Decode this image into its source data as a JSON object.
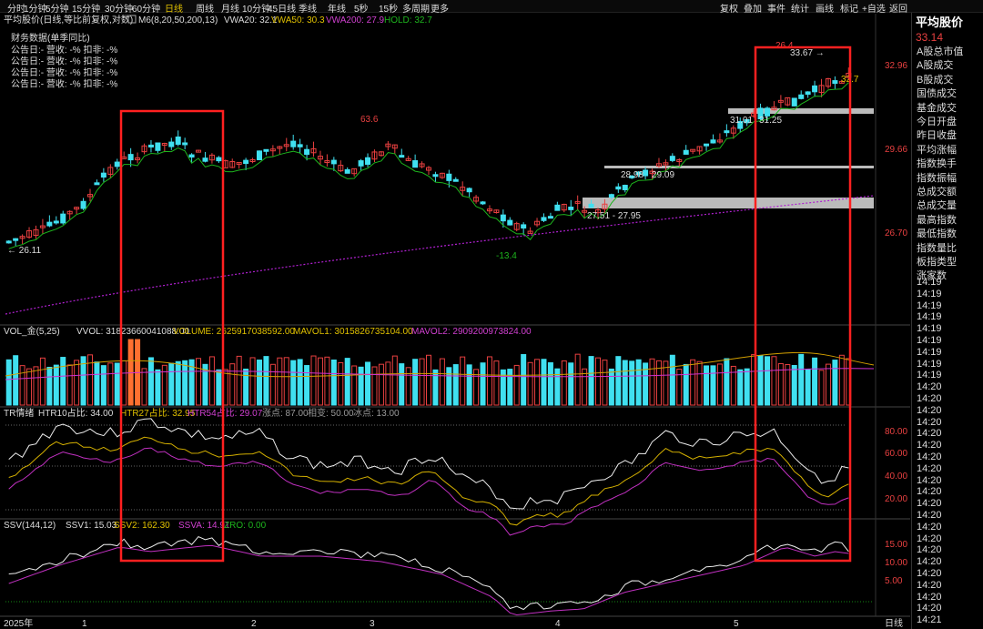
{
  "topbar": {
    "periods": [
      "分时",
      "1分钟",
      "5分钟",
      "15分钟",
      "30分钟",
      "60分钟",
      "日线",
      "周线",
      "月线",
      "10分钟",
      "45日线",
      "季线",
      "年线",
      "5秒",
      "15秒",
      "多周期",
      "更多"
    ],
    "active_period": "日线",
    "actions": [
      "复权",
      "叠加",
      "事件",
      "统计",
      "画线",
      "标记",
      "+自选",
      "返回"
    ]
  },
  "main_header": {
    "title": "平均股价(日线,等比前复权,对数)",
    "indicator": "M6(8,20,50,200,13)",
    "vwa20": "VWA20: 32.1",
    "vwa50": "VWA50: 30.3",
    "vwa200": "VWA200: 27.9",
    "hold": "HOLD: 32.7"
  },
  "finance": {
    "title": "财务数据(单季同比)",
    "rows": [
      "公告日:-  营收: -%  扣非: -%",
      "公告日:-  营收: -%  扣非: -%",
      "公告日:-  营收: -%  扣非: -%",
      "公告日:-  营收: -%  扣非: -%"
    ]
  },
  "price_axis": [
    "32.96",
    "29.66",
    "26.70"
  ],
  "annotations": {
    "low_left": "26.11",
    "peak_mid": "63.6",
    "trough": "-13.4",
    "peak_right": "26.4",
    "hi": "33.67",
    "last": "32.7",
    "s1": "31.01",
    "s2": "31.25",
    "s3": "28.98",
    "s4": "29.09",
    "s5": "27.51 - 27.95"
  },
  "vol_header": {
    "name": "VOL_金(5,25)",
    "vvol": "VVOL: 31823660041088.00",
    "volume": "VOLUME: 2625917038592.00",
    "mavol1": "MAVOL1: 3015826735104.00",
    "mavol2": "MAVOL2: 2909200973824.00"
  },
  "tr_header": {
    "name": "TR情绪",
    "htr10": "HTR10占比: 34.00",
    "htr27": "HTR27占比: 32.95",
    "htr54": "HTR54占比: 29.07",
    "hot": "涨点: 87.00",
    "neutral": "相变: 50.00",
    "cold": "冰点: 13.00"
  },
  "tr_axis": [
    "80.00",
    "60.00",
    "40.00",
    "20.00"
  ],
  "ssv_header": {
    "name": "SSV(144,12)",
    "ssv1": "SSV1: 15.03",
    "ssv2": "SSV2: 162.30",
    "ssva": "SSVA: 14.91",
    "zro": "ZRO: 0.00"
  },
  "ssv_axis": [
    "15.00",
    "10.00",
    "5.00"
  ],
  "x_axis": [
    "2025年",
    "1",
    "2",
    "3",
    "4",
    "5"
  ],
  "x_axis_right": "日线",
  "sidebar": {
    "title": "平均股价",
    "price": "33.14",
    "items": [
      "A股总市值",
      "A股成交",
      "B股成交",
      "国债成交",
      "基金成交",
      "今日开盘",
      "昨日收盘",
      "平均涨幅",
      "指数换手",
      "指数振幅",
      "总成交额",
      "总成交量",
      "最高指数",
      "最低指数",
      "指数量比",
      "板指类型",
      "涨家数"
    ],
    "times": [
      "14:19",
      "14:19",
      "14:19",
      "14:19",
      "14:19",
      "14:19",
      "14:19",
      "14:19",
      "14:19",
      "14:20",
      "14:20",
      "14:20",
      "14:20",
      "14:20",
      "14:20",
      "14:20",
      "14:20",
      "14:20",
      "14:20",
      "14:20",
      "14:20",
      "14:20",
      "14:20",
      "14:20",
      "14:20",
      "14:20",
      "14:20",
      "14:20",
      "14:20",
      "14:21"
    ]
  },
  "colors": {
    "up": "#e84040",
    "down": "#40e0f0",
    "ma": "#1db41d",
    "ma200": "#b020d0",
    "highlight": "#ff2020",
    "vol_ma1": "#d4a000",
    "vol_ma2": "#d030d0"
  }
}
